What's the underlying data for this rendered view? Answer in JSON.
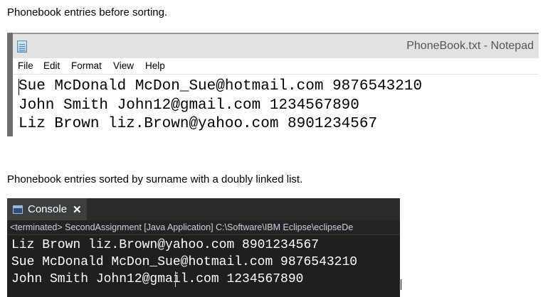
{
  "captions": {
    "before": "Phonebook entries before sorting.",
    "after": "Phonebook entries sorted by surname with a doubly linked list."
  },
  "notepad": {
    "title": "PhoneBook.txt - Notepad",
    "icon": "notepad-icon",
    "menu": [
      "File",
      "Edit",
      "Format",
      "View",
      "Help"
    ],
    "lines": [
      "Sue McDonald McDon_Sue@hotmail.com 9876543210",
      "John Smith John12@gmail.com 1234567890",
      "Liz Brown liz.Brown@yahoo.com 8901234567"
    ]
  },
  "console": {
    "tab_label": "Console",
    "tab_icon": "console-icon",
    "close_icon": "close-icon",
    "status": "<terminated> SecondAssignment [Java Application] C:\\Software\\IBM Eclipse\\eclipseDe",
    "lines": [
      "Liz Brown liz.Brown@yahoo.com 8901234567",
      "Sue McDonald McDon_Sue@hotmail.com 9876543210",
      "John Smith John12@gmail.com 1234567890"
    ]
  },
  "colors": {
    "console_bg": "#1f1f1f",
    "console_text": "#ffffff",
    "notepad_titlebar": "#e2e2e2"
  }
}
